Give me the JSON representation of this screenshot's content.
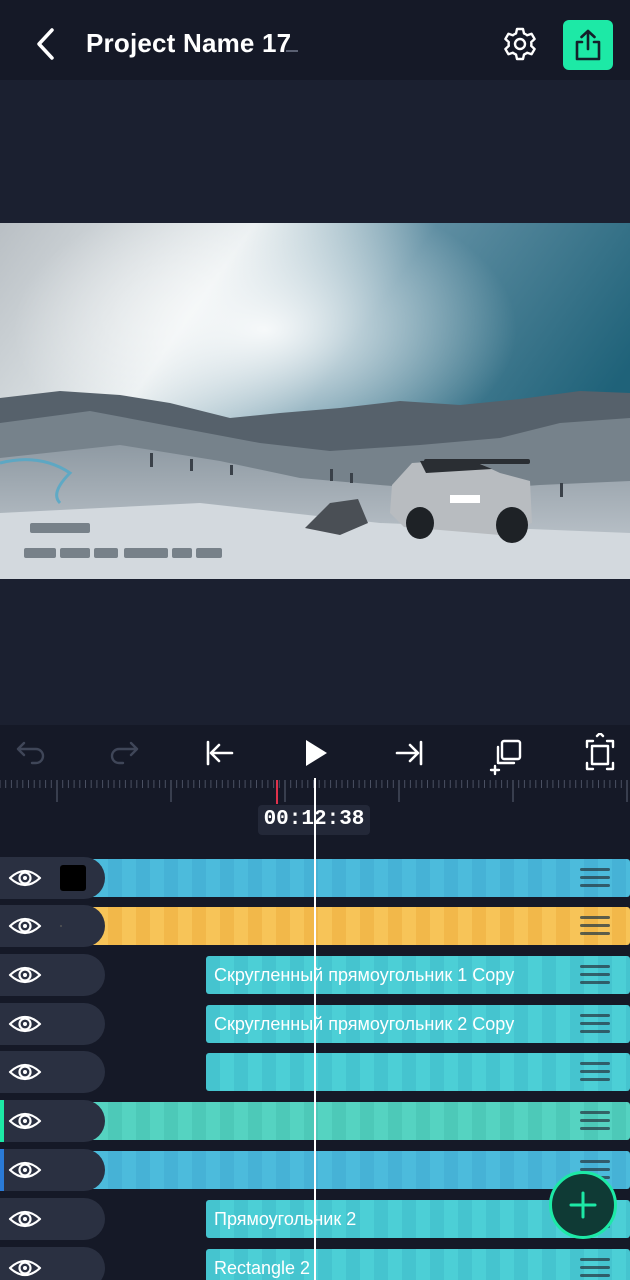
{
  "header": {
    "title": "Project Name 17",
    "back_icon": "chevron-left-icon",
    "settings_icon": "gear-icon",
    "share_icon": "share-upload-icon",
    "accent": "#1de9a6"
  },
  "toolbar": {
    "icons": [
      "undo-icon",
      "redo-icon",
      "skip-to-start-icon",
      "play-icon",
      "skip-to-end-icon",
      "duplicate-icon",
      "fit-frame-icon"
    ],
    "timecode": "00:12:38"
  },
  "tracks": [
    {
      "visible": true,
      "kind": "solid",
      "color": "#000000",
      "clip_color": "blue",
      "label": ""
    },
    {
      "visible": true,
      "kind": "empty",
      "clip_color": "orange",
      "label": ""
    },
    {
      "visible": true,
      "kind": "text",
      "clip_color": "teal",
      "label": "Скругленный прямоугольник 1 Copy"
    },
    {
      "visible": true,
      "kind": "text",
      "clip_color": "teal",
      "label": "Скругленный прямоугольник 2 Copy"
    },
    {
      "visible": true,
      "kind": "text",
      "clip_color": "teal",
      "label": ""
    },
    {
      "visible": true,
      "kind": "marker",
      "marker_color": "#1de9a6",
      "clip_color": "mint",
      "label": ""
    },
    {
      "visible": true,
      "kind": "marker",
      "marker_color": "#2a7ad6",
      "clip_color": "blue",
      "label": ""
    },
    {
      "visible": true,
      "kind": "text",
      "clip_color": "teal",
      "label": "Прямоугольник 2"
    },
    {
      "visible": true,
      "kind": "text",
      "clip_color": "teal",
      "label": "Rectangle 2"
    }
  ],
  "add_button_icon": "plus-icon"
}
